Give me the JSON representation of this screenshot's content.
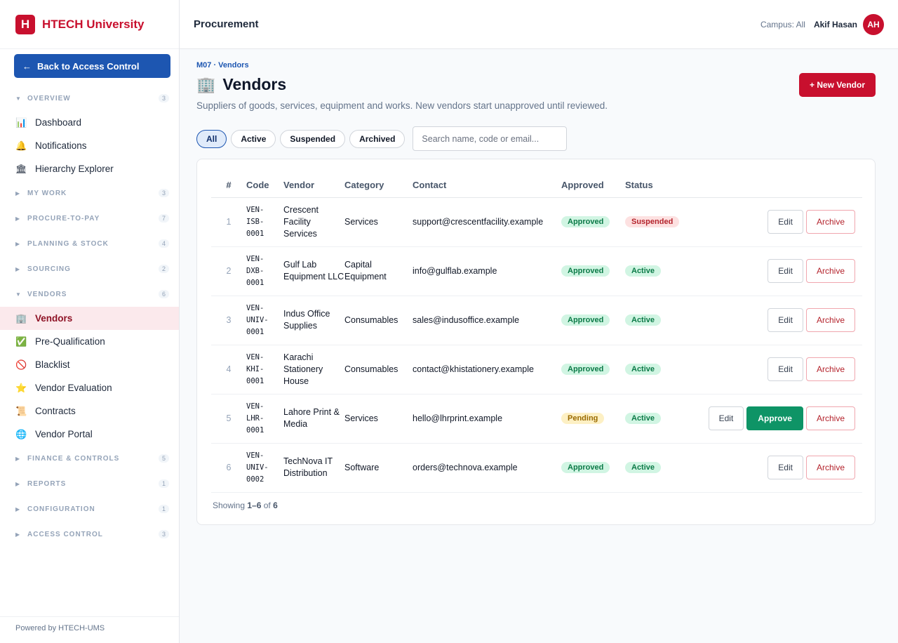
{
  "brand": {
    "logo_letter": "H",
    "name": "HTECH University"
  },
  "sidebar": {
    "back_label": "Back to Access Control",
    "back_arrow": "←",
    "footer": "Powered by HTECH-UMS",
    "sections": [
      {
        "label": "OVERVIEW",
        "count": "3",
        "expanded": true,
        "items": [
          {
            "icon": "📊",
            "label": "Dashboard"
          },
          {
            "icon": "🔔",
            "label": "Notifications"
          },
          {
            "icon": "🏛",
            "label": "Hierarchy Explorer"
          }
        ]
      },
      {
        "label": "MY WORK",
        "count": "3",
        "expanded": false
      },
      {
        "label": "PROCURE-TO-PAY",
        "count": "7",
        "expanded": false
      },
      {
        "label": "PLANNING & STOCK",
        "count": "4",
        "expanded": false
      },
      {
        "label": "SOURCING",
        "count": "2",
        "expanded": false
      },
      {
        "label": "VENDORS",
        "count": "6",
        "expanded": true,
        "items": [
          {
            "icon": "🏢",
            "label": "Vendors",
            "active": true
          },
          {
            "icon": "✅",
            "label": "Pre-Qualification"
          },
          {
            "icon": "🚫",
            "label": "Blacklist"
          },
          {
            "icon": "⭐",
            "label": "Vendor Evaluation"
          },
          {
            "icon": "📜",
            "label": "Contracts"
          },
          {
            "icon": "🌐",
            "label": "Vendor Portal"
          }
        ]
      },
      {
        "label": "FINANCE & CONTROLS",
        "count": "5",
        "expanded": false
      },
      {
        "label": "REPORTS",
        "count": "1",
        "expanded": false
      },
      {
        "label": "CONFIGURATION",
        "count": "1",
        "expanded": false
      },
      {
        "label": "ACCESS CONTROL",
        "count": "3",
        "expanded": false
      }
    ]
  },
  "topbar": {
    "title": "Procurement",
    "campus": "Campus: All",
    "user": "Akif Hasan",
    "initials": "AH"
  },
  "page": {
    "crumb": "M07 · Vendors",
    "icon": "🏢",
    "title": "Vendors",
    "subtitle": "Suppliers of goods, services, equipment and works. New vendors start unapproved until reviewed.",
    "new_button": "+ New Vendor"
  },
  "filters": {
    "chips": [
      {
        "label": "All",
        "active": true
      },
      {
        "label": "Active",
        "active": false
      },
      {
        "label": "Suspended",
        "active": false
      },
      {
        "label": "Archived",
        "active": false
      }
    ],
    "search_placeholder": "Search name, code or email..."
  },
  "table": {
    "columns": [
      "#",
      "Code",
      "Vendor",
      "Category",
      "Contact",
      "Approved",
      "Status"
    ],
    "rows": [
      {
        "num": "1",
        "code": "VEN-\nISB-\n0001",
        "vendor": "Crescent Facility Services",
        "category": "Services",
        "contact": "support@crescentfacility.example",
        "approved": "Approved",
        "status": "Suspended",
        "can_approve": false
      },
      {
        "num": "2",
        "code": "VEN-\nDXB-\n0001",
        "vendor": "Gulf Lab Equipment LLC",
        "category": "Capital Equipment",
        "contact": "info@gulflab.example",
        "approved": "Approved",
        "status": "Active",
        "can_approve": false
      },
      {
        "num": "3",
        "code": "VEN-\nUNIV-\n0001",
        "vendor": "Indus Office Supplies",
        "category": "Consumables",
        "contact": "sales@indusoffice.example",
        "approved": "Approved",
        "status": "Active",
        "can_approve": false
      },
      {
        "num": "4",
        "code": "VEN-\nKHI-\n0001",
        "vendor": "Karachi Stationery House",
        "category": "Consumables",
        "contact": "contact@khistationery.example",
        "approved": "Approved",
        "status": "Active",
        "can_approve": false
      },
      {
        "num": "5",
        "code": "VEN-\nLHR-\n0001",
        "vendor": "Lahore Print & Media",
        "category": "Services",
        "contact": "hello@lhrprint.example",
        "approved": "Pending",
        "status": "Active",
        "can_approve": true
      },
      {
        "num": "6",
        "code": "VEN-\nUNIV-\n0002",
        "vendor": "TechNova IT Distribution",
        "category": "Software",
        "contact": "orders@technova.example",
        "approved": "Approved",
        "status": "Active",
        "can_approve": false
      }
    ],
    "actions": {
      "edit": "Edit",
      "approve": "Approve",
      "archive": "Archive"
    },
    "footer": {
      "prefix": "Showing ",
      "range": "1–6",
      "of": " of ",
      "total": "6"
    }
  }
}
